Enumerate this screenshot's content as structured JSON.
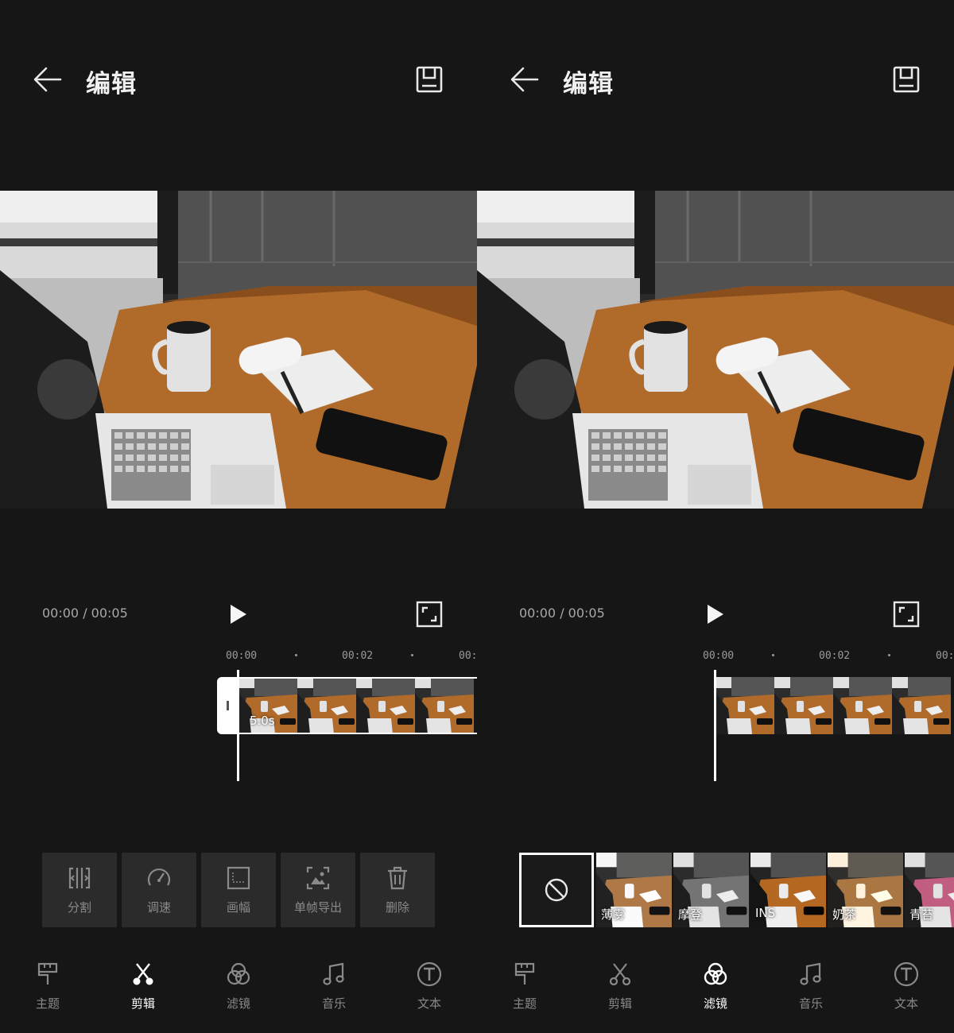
{
  "header": {
    "title": "编辑"
  },
  "player": {
    "time": "00:00 / 00:05"
  },
  "ruler": {
    "ticks": [
      "00:00",
      "00:02",
      "00:0"
    ]
  },
  "clip": {
    "duration": "5.0s"
  },
  "tools": [
    {
      "label": "分割",
      "icon": "split-icon"
    },
    {
      "label": "调速",
      "icon": "speed-gauge-icon"
    },
    {
      "label": "画幅",
      "icon": "aspect-ratio-icon"
    },
    {
      "label": "单帧导出",
      "icon": "frame-export-icon"
    },
    {
      "label": "删除",
      "icon": "trash-icon"
    }
  ],
  "filters": [
    {
      "label": "薄雾"
    },
    {
      "label": "摩登"
    },
    {
      "label": "INS"
    },
    {
      "label": "奶茶"
    },
    {
      "label": "青苔"
    }
  ],
  "nav": [
    {
      "label": "主题",
      "icon": "brush-icon"
    },
    {
      "label": "剪辑",
      "icon": "scissors-icon"
    },
    {
      "label": "滤镜",
      "icon": "filter-circles-icon"
    },
    {
      "label": "音乐",
      "icon": "music-note-icon"
    },
    {
      "label": "文本",
      "icon": "text-t-icon"
    }
  ],
  "screens": {
    "left": {
      "active_nav": "剪辑"
    },
    "right": {
      "active_nav": "滤镜"
    }
  },
  "colors": {
    "background": "#161616",
    "tool_bg": "#2b2b2b",
    "active": "#ffffff",
    "inactive": "#8a8a8a"
  }
}
